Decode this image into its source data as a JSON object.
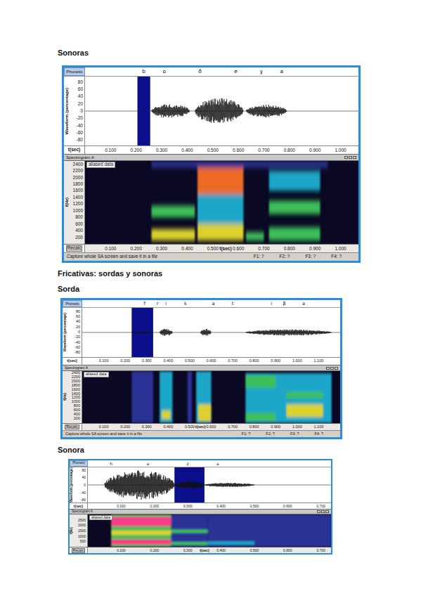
{
  "items": [
    {
      "kind": "heading",
      "text": "Sonoras"
    },
    {
      "kind": "screen",
      "screen": {
        "phonetic_label": "Phonetic",
        "t_end": 1.07,
        "segments": [
          {
            "label": "b",
            "t": 0.23
          },
          {
            "label": "o",
            "t": 0.31
          },
          {
            "label": "ð",
            "t": 0.45
          },
          {
            "label": "e",
            "t": 0.59
          },
          {
            "label": "ɣ",
            "t": 0.69
          },
          {
            "label": "a",
            "t": 0.77
          }
        ],
        "selection": {
          "start": 0.205,
          "end": 0.255
        },
        "waveform": {
          "axis_label": "Waveform (percentage)",
          "ticks": [
            "80",
            "60",
            "40",
            "20",
            "0",
            "-20",
            "-40",
            "-60",
            "-80"
          ],
          "time_label": "t(sec)",
          "time_ticks": [
            "0.100",
            "0.200",
            "0.300",
            "0.400",
            "0.500",
            "0.600",
            "0.700",
            "0.800",
            "0.900",
            "1.000"
          ],
          "bursts": [
            {
              "start": 0.26,
              "end": 0.41,
              "amp": 20
            },
            {
              "start": 0.43,
              "end": 0.62,
              "amp": 36
            },
            {
              "start": 0.63,
              "end": 0.79,
              "amp": 18
            }
          ]
        },
        "spectrogram": {
          "title": "Spectrogram A",
          "badge": "aliased data",
          "axis_label": "f(Hz)",
          "fmax": 2500,
          "ticks": [
            "2400",
            "2200",
            "2000",
            "1800",
            "1600",
            "1400",
            "1200",
            "1000",
            "800",
            "600",
            "400",
            "200"
          ],
          "recalc": "Recalc",
          "time_label": "t(sec)",
          "time_label_at": 0.55,
          "time_ticks": [
            "0.100",
            "0.200",
            "0.300",
            "0.400",
            "0.500",
            "0.600",
            "0.700",
            "0.800",
            "0.900",
            "1.000"
          ],
          "regions": [
            {
              "t0": 0.26,
              "t1": 0.95,
              "f0": 2300,
              "f1": 2500,
              "energy": 0.3
            },
            {
              "t0": 0.44,
              "t1": 0.62,
              "f0": 600,
              "f1": 1500,
              "energy": 0.4
            },
            {
              "t0": 0.72,
              "t1": 0.92,
              "f0": 1600,
              "f1": 2200,
              "energy": 0.45
            },
            {
              "t0": 0.63,
              "t1": 0.7,
              "f0": 100,
              "f1": 350,
              "energy": 0.55
            },
            {
              "t0": 0.26,
              "t1": 0.43,
              "f0": 800,
              "f1": 1150,
              "energy": 0.65
            },
            {
              "t0": 0.72,
              "t1": 0.92,
              "f0": 900,
              "f1": 1300,
              "energy": 0.65
            },
            {
              "t0": 0.72,
              "t1": 0.92,
              "f0": 100,
              "f1": 500,
              "energy": 0.7
            },
            {
              "t0": 0.26,
              "t1": 0.43,
              "f0": 100,
              "f1": 450,
              "energy": 0.75
            },
            {
              "t0": 0.44,
              "t1": 0.62,
              "f0": 100,
              "f1": 600,
              "energy": 0.8
            },
            {
              "t0": 0.44,
              "t1": 0.62,
              "f0": 1500,
              "f1": 2300,
              "energy": 0.9
            },
            {
              "t0": 0.46,
              "t1": 0.6,
              "f0": 1900,
              "f1": 2250,
              "energy": 0.95
            }
          ]
        },
        "status": {
          "text": "Capture whole SA screen and save it in a file",
          "formants": [
            "F1: ?",
            "F2: ?",
            "F3: ?",
            "F4: ?"
          ]
        }
      }
    },
    {
      "kind": "heading",
      "text": "Fricativas: sordas y sonoras"
    },
    {
      "kind": "heading",
      "text": "Sorda"
    },
    {
      "kind": "screen",
      "screen": {
        "phonetic_label": "Phonetic",
        "t_end": 1.2,
        "segments": [
          {
            "label": "f",
            "t": 0.29
          },
          {
            "label": "r",
            "t": 0.35
          },
          {
            "label": "i",
            "t": 0.39
          },
          {
            "label": "k",
            "t": 0.48
          },
          {
            "label": "a",
            "t": 0.61
          },
          {
            "label": "t",
            "t": 0.7
          },
          {
            "label": "i",
            "t": 0.88
          },
          {
            "label": "β",
            "t": 0.94
          },
          {
            "label": "a",
            "t": 1.03
          }
        ],
        "selection": {
          "start": 0.23,
          "end": 0.33
        },
        "waveform": {
          "axis_label": "Waveform (percentage)",
          "ticks": [
            "80",
            "60",
            "40",
            "20",
            "0",
            "-20",
            "-40",
            "-60",
            "-80"
          ],
          "time_label": "t(sec)",
          "time_ticks": [
            "0.100",
            "0.200",
            "0.300",
            "0.400",
            "0.500",
            "0.600",
            "0.700",
            "0.800",
            "0.900",
            "1.000",
            "1.100"
          ],
          "bursts": [
            {
              "start": 0.23,
              "end": 0.33,
              "amp": 3
            },
            {
              "start": 0.36,
              "end": 0.42,
              "amp": 14
            },
            {
              "start": 0.55,
              "end": 0.6,
              "amp": 14
            },
            {
              "start": 0.76,
              "end": 1.16,
              "amp": 12
            }
          ]
        },
        "spectrogram": {
          "title": "Spectrogram A",
          "badge": "aliased data",
          "axis_label": "f(Hz)",
          "fmax": 2500,
          "ticks": [
            "2400",
            "2200",
            "2000",
            "1800",
            "1600",
            "1400",
            "1200",
            "1000",
            "800",
            "600",
            "400",
            "200"
          ],
          "recalc": "Recalc",
          "time_label": "t(sec)",
          "time_label_at": 0.55,
          "time_ticks": [
            "0.100",
            "0.200",
            "0.300",
            "0.400",
            "0.500",
            "0.600",
            "0.700",
            "0.800",
            "0.900",
            "1.000",
            "1.100"
          ],
          "regions": [
            {
              "t0": 0.23,
              "t1": 0.33,
              "f0": 0,
              "f1": 2500,
              "energy": 0.3
            },
            {
              "t0": 0.49,
              "t1": 0.51,
              "f0": 0,
              "f1": 2500,
              "energy": 0.35
            },
            {
              "t0": 0.76,
              "t1": 1.16,
              "f0": 0,
              "f1": 2400,
              "energy": 0.4
            },
            {
              "t0": 0.36,
              "t1": 0.42,
              "f0": 0,
              "f1": 2500,
              "energy": 0.45
            },
            {
              "t0": 0.53,
              "t1": 0.6,
              "f0": 0,
              "f1": 2500,
              "energy": 0.5
            },
            {
              "t0": 0.76,
              "t1": 0.9,
              "f0": 1700,
              "f1": 2300,
              "energy": 0.6
            },
            {
              "t0": 0.95,
              "t1": 1.12,
              "f0": 1200,
              "f1": 1500,
              "energy": 0.6
            },
            {
              "t0": 0.76,
              "t1": 0.9,
              "f0": 100,
              "f1": 500,
              "energy": 0.7
            },
            {
              "t0": 0.37,
              "t1": 0.41,
              "f0": 200,
              "f1": 600,
              "energy": 0.75
            },
            {
              "t0": 0.95,
              "t1": 1.12,
              "f0": 300,
              "f1": 900,
              "energy": 0.75
            },
            {
              "t0": 0.54,
              "t1": 0.6,
              "f0": 100,
              "f1": 900,
              "energy": 0.8
            }
          ]
        },
        "status": {
          "text": "Capture whole SA screen and save it in a file",
          "formants": [
            "F1: ?",
            "F2: ?",
            "F3: ?",
            "F4: ?"
          ]
        }
      }
    },
    {
      "kind": "heading",
      "text": "Sonora"
    },
    {
      "kind": "screen",
      "screen": {
        "phonetic_label": "Phonetic",
        "t_end": 0.73,
        "segments": [
          {
            "label": "h",
            "t": 0.07
          },
          {
            "label": "a",
            "t": 0.18
          },
          {
            "label": "z",
            "t": 0.3
          },
          {
            "label": "a",
            "t": 0.39
          }
        ],
        "selection": {
          "start": 0.26,
          "end": 0.35
        },
        "waveform": {
          "axis_label": "Waveform (percentage)",
          "ticks": [
            "80",
            "40",
            "0",
            "-40",
            "-80"
          ],
          "time_label": "t(sec)",
          "time_ticks": [
            "0.100",
            "0.200",
            "0.300",
            "0.400",
            "0.500",
            "0.600",
            "0.700"
          ],
          "bursts": [
            {
              "start": 0.05,
              "end": 0.26,
              "amp": 80
            },
            {
              "start": 0.26,
              "end": 0.35,
              "amp": 22
            },
            {
              "start": 0.35,
              "end": 0.5,
              "amp": 12
            }
          ]
        },
        "spectrogram": {
          "title": "Spectrogram A",
          "badge": "aliased data",
          "axis_label": "f(Hz)",
          "fmax": 3000,
          "ticks": [
            "2500",
            "2000",
            "1500",
            "1000",
            "500"
          ],
          "recalc": "Recalc",
          "time_label": "t(sec)",
          "time_label_at": 0.35,
          "time_ticks": [
            "0.100",
            "0.200",
            "0.300",
            "0.400",
            "0.500",
            "0.600",
            "0.700"
          ],
          "regions": [
            {
              "t0": 0.36,
              "t1": 0.73,
              "f0": 0,
              "f1": 3000,
              "energy": 0.2
            },
            {
              "t0": 0.25,
              "t1": 0.36,
              "f0": 0,
              "f1": 3000,
              "energy": 0.35
            },
            {
              "t0": 0.36,
              "t1": 0.5,
              "f0": 200,
              "f1": 500,
              "energy": 0.45
            },
            {
              "t0": 0.25,
              "t1": 0.36,
              "f0": 1300,
              "f1": 1600,
              "energy": 0.55
            },
            {
              "t0": 0.07,
              "t1": 0.25,
              "f0": 0,
              "f1": 3000,
              "energy": 0.6
            },
            {
              "t0": 0.25,
              "t1": 0.36,
              "f0": 150,
              "f1": 450,
              "energy": 0.7
            },
            {
              "t0": 0.07,
              "t1": 0.25,
              "f0": 1100,
              "f1": 1500,
              "energy": 0.85
            },
            {
              "t0": 0.07,
              "t1": 0.25,
              "f0": 1900,
              "f1": 2800,
              "energy": 0.98
            },
            {
              "t0": 0.07,
              "t1": 0.25,
              "f0": 200,
              "f1": 700,
              "energy": 0.98
            }
          ]
        }
      }
    }
  ]
}
